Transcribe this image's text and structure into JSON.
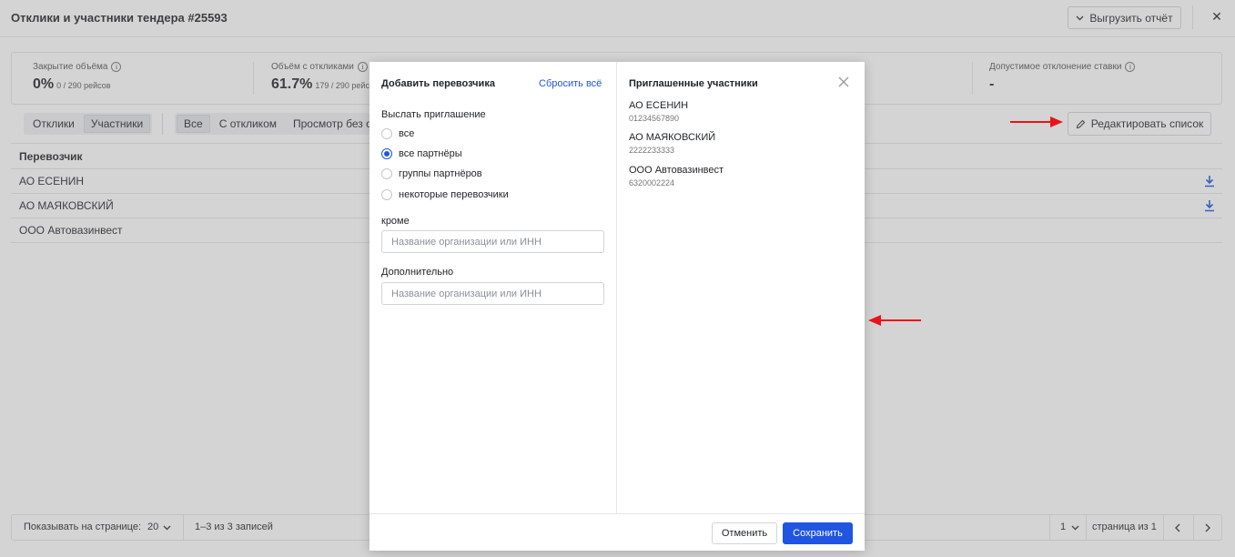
{
  "header": {
    "title": "Отклики и участники тендера #25593",
    "export_label": "Выгрузить отчёт",
    "close_glyph": "✕"
  },
  "stats": [
    {
      "label": "Закрытие объёма",
      "value": "0%",
      "sub": "0 / 290 рейсов"
    },
    {
      "label": "Объём с откликами",
      "value": "61.7%",
      "sub": "179 / 290 рейс"
    },
    {
      "label": "Допустимое отклонение ставки",
      "value": "-",
      "sub": ""
    }
  ],
  "toolbar": {
    "view_tabs": [
      "Отклики",
      "Участники"
    ],
    "filter_tabs": [
      "Все",
      "С откликом",
      "Просмотр без от"
    ],
    "edit_label": "Редактировать список"
  },
  "table": {
    "header": "Перевозчик",
    "rows": [
      "АО ЕСЕНИН",
      "АО МАЯКОВСКИЙ",
      "ООО Автовазинвест"
    ]
  },
  "footer": {
    "per_page_label": "Показывать на странице:",
    "per_page_value": "20",
    "records": "1–3 из 3 записей",
    "page_value": "1",
    "page_of": "страница из 1"
  },
  "modal": {
    "left_title": "Добавить перевозчика",
    "reset_label": "Сбросить всё",
    "invite_label": "Выслать приглашение",
    "radio_options": [
      "все",
      "все партнёры",
      "группы партнёров",
      "некоторые перевозчики"
    ],
    "except_label": "кроме",
    "except_placeholder": "Название организации или ИНН",
    "additional_label": "Дополнительно",
    "additional_placeholder": "Название организации или ИНН",
    "right_title": "Приглашенные участники",
    "participants": [
      {
        "name": "АО ЕСЕНИН",
        "inn": "01234567890"
      },
      {
        "name": "АО МАЯКОВСКИЙ",
        "inn": "2222233333"
      },
      {
        "name": "ООО Автовазинвест",
        "inn": "6320002224"
      }
    ],
    "cancel_label": "Отменить",
    "save_label": "Сохранить"
  },
  "colors": {
    "accent": "#1f55e0",
    "annotation": "#e8141b"
  }
}
